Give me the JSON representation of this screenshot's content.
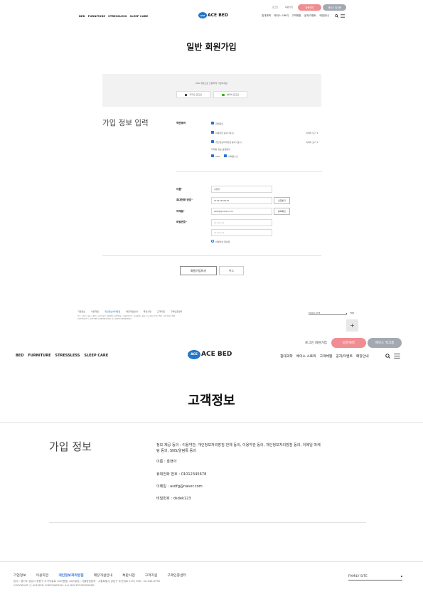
{
  "form_page": {
    "util_links": [
      "로그인",
      "회원가입"
    ],
    "pill_buttons": [
      "방문예약",
      "에이스 워크폼"
    ],
    "nav_left": [
      "BED",
      "FURNITURE",
      "STRESSLESS",
      "SLEEP CARE"
    ],
    "logo": {
      "badge": "ACE",
      "text": "ACE BED"
    },
    "nav_right": [
      "침대과학",
      "에이스 스토리",
      "고객체험",
      "공지/이벤트",
      "매장안내"
    ],
    "title": "일반 회원가입",
    "sns": {
      "prompt": "SNS 계정으로 간편하게 가입하세요!",
      "kakao": "카카오 로그인",
      "naver": "네이버 로그인"
    },
    "section_title": "가입 정보 입력",
    "terms": {
      "label": "약관동의",
      "all": "전체동의",
      "item1": "이용약관 동의 (필수)",
      "item2": "개인정보처리방침 동의 (필수)",
      "view": "자세히 보기 ▾",
      "marketing_label": "마케팅 정보 활용동의",
      "sms": "SMS",
      "email": "이메일수신"
    },
    "fields": {
      "name_label": "이름",
      "name_value": "홍현아",
      "phone_label": "휴대전화 번호",
      "phone_value": "01012345678",
      "phone_btn": "인증받기",
      "email_label": "이메일",
      "email_value": "asdfg@naver.com",
      "email_btn": "중복확인",
      "pw_label": "비밀번호",
      "pw_value": "••••••••",
      "pw_confirm_value": "••••••••",
      "pw_note": "비밀번호 재설정"
    },
    "buttons": {
      "submit": "회원가입하기",
      "cancel": "취소"
    },
    "footer": {
      "links": [
        "기업정보",
        "이용약관",
        "개인정보처리방침",
        "매장개설안내",
        "특판사업",
        "고객지원",
        "구매인증센터"
      ],
      "address": "본사 : 경기도 성남시 중원구 사기막골로 100(원동) ACE빌딩 | 서울영업본부 : 서울특별시 강남구 도산대로 219 | FAX : 02-544-6798",
      "copyright": "COPYRIGHT ⓒ ACE BED CORPORATION. ALL RIGHTS RESERVED.",
      "family_site": "FAMILY SITE",
      "top_label": "TOP",
      "plus": "+"
    }
  },
  "info_page": {
    "util_links": [
      "로그인",
      "회원가입"
    ],
    "pill_buttons": [
      "방문예약",
      "에이스 워크폼"
    ],
    "nav_left": [
      "BED",
      "FURNITURE",
      "STRESSLESS",
      "SLEEP CARE"
    ],
    "logo": {
      "badge": "ACE",
      "text": "ACE BED"
    },
    "nav_right": [
      "침대과학",
      "에이스 스토리",
      "고객체험",
      "공지/이벤트",
      "매장안내"
    ],
    "title": "고객정보",
    "section_title": "가입 정보",
    "consent": "정보 제공 동의 : 이용약관, 개인정보처리방침 전체 동의, 이용약관 동의, 개인정보처리방침 동의, 이메일 마케팅 동의, SNS/알림톡 동의",
    "name": "이름 : 홍현아",
    "phone": "휴대전화 번호 : 01012345678",
    "email": "이메일 : asdfg@naver.com",
    "password": "비밀번호 : dsdek123",
    "footer": {
      "links": [
        "기업정보",
        "이용약관",
        "개인정보처리방침",
        "매장개설안내",
        "특판사업",
        "고객지원",
        "구매인증센터"
      ],
      "address": "본사 : 경기도 성남시 중원구 사기막골로 100(원동) ACE빌딩 | 서울영업본부 : 서울특별시 강남구 도산대로 219 | FAX : 02-544-6798",
      "copyright": "COPYRIGHT ⓒ ACE BED CORPORATION. ALL RIGHTS RESERVED.",
      "family_site": "FAMILY SITE"
    }
  },
  "colors": {
    "pink": "#f08d92",
    "grey_pill": "#a3a9b1",
    "brand_blue": "#2377c6",
    "checkbox_blue": "#2a6fd1",
    "highlight_link": "#2e6fd8"
  },
  "icons": [
    "search-icon",
    "menu-icon",
    "kakao-icon",
    "naver-icon",
    "checkbox-icon",
    "plus-icon"
  ]
}
